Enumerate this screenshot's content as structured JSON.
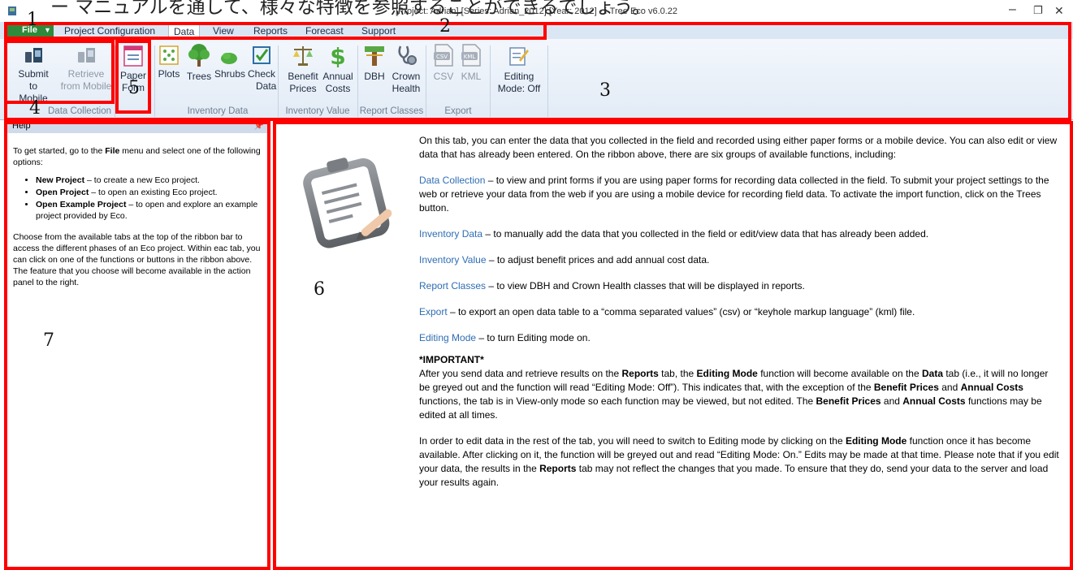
{
  "caption_jp": "ー マニュアルを通して、様々な特徴を参照することができるでしょう。",
  "window": {
    "title": "[Project: Adrian] [Series: Adrian_2012] [Year: 2012] - i-Tree Eco v6.0.22",
    "minimize": "–",
    "restore": "❐",
    "close": "✕"
  },
  "menu": {
    "file": "File",
    "tabs": [
      "Project Configuration",
      "Data",
      "View",
      "Reports",
      "Forecast",
      "Support"
    ]
  },
  "ribbon": {
    "submit_mobile": [
      "Submit",
      "to Mobile"
    ],
    "retrieve_mobile": [
      "Retrieve",
      "from Mobile"
    ],
    "paper_form": [
      "Paper",
      "Form"
    ],
    "plots": "Plots",
    "trees": "Trees",
    "shrubs": "Shrubs",
    "check_data": [
      "Check",
      "Data"
    ],
    "benefit_prices": [
      "Benefit",
      "Prices"
    ],
    "annual_costs": [
      "Annual",
      "Costs"
    ],
    "dbh": "DBH",
    "crown_health": [
      "Crown",
      "Health"
    ],
    "csv": "CSV",
    "kml": "KML",
    "editing_mode": [
      "Editing",
      "Mode: Off"
    ],
    "groups": {
      "data_collection": "Data Collection",
      "inventory_data": "Inventory Data",
      "inventory_value": "Inventory Value",
      "report_classes": "Report Classes",
      "export": "Export"
    }
  },
  "help": {
    "title": "Help",
    "pin": "📌",
    "intro_a": "To get started, go to the ",
    "intro_bold": "File",
    "intro_b": " menu and select one of the following options:",
    "items": [
      {
        "bold": "New Project",
        "text": " – to create a new Eco project."
      },
      {
        "bold": "Open Project",
        "text": " – to open an existing Eco project."
      },
      {
        "bold": "Open Example Project",
        "text": " – to open and explore an example project provided by Eco."
      }
    ],
    "outro": "Choose from the available tabs at the top of the ribbon bar to access the different phases of an Eco project. Within eac tab, you can click on one of the functions or buttons in the ribbon above. The feature that you choose will become available in the action panel to the right."
  },
  "action": {
    "intro": "On this tab, you can enter the data that you collected in the field and recorded using either paper forms or a mobile device. You can also edit or view data that has already been entered. On the ribbon above, there are six groups of available functions, including:",
    "items": [
      {
        "title": "Data Collection",
        "text": " – to view and print forms if you are using paper forms for recording data collected in the field. To submit your project settings to the web or retrieve your data from the web if you are using a mobile device for recording field data. To activate the import function, click on the Trees button."
      },
      {
        "title": "Inventory Data",
        "text": " – to manually add the data that you collected in the field or edit/view data that has already been added."
      },
      {
        "title": "Inventory Value",
        "text": " – to adjust benefit prices and add annual cost data."
      },
      {
        "title": "Report Classes",
        "text": " – to view DBH and Crown Health classes that will be displayed in reports."
      },
      {
        "title": "Export",
        "text": " –  to export an open data table to a “comma separated values” (csv) or “keyhole markup language” (kml) file."
      },
      {
        "title": "Editing Mode",
        "text": " – to turn Editing mode on."
      }
    ],
    "important_title": "*IMPORTANT*",
    "imp1": {
      "t1": "After you send data and retrieve results on the ",
      "b1": "Reports",
      "t2": " tab, the ",
      "b2": "Editing Mode",
      "t3": " function will become available on the ",
      "b3": "Data",
      "t4": " tab (i.e., it will no longer be greyed out and the function will read “Editing Mode: Off”). This indicates that, with the exception of the ",
      "b4": "Benefit Prices",
      "t5": " and ",
      "b5": "Annual Costs",
      "t6": " functions, the tab is in View-only mode so each function may be viewed, but not edited. The ",
      "b6": "Benefit Prices",
      "t7": " and ",
      "b7": "Annual Costs",
      "t8": " functions may be edited at all times."
    },
    "imp2": {
      "t1": "In order to edit data in the rest of the tab, you will need to switch to Editing mode by clicking on the ",
      "b1": "Editing Mode",
      "t2": " function once it has become available. After clicking on it, the function will be greyed out and read “Editing Mode: On.” Edits may be made at that time. Please note that if you edit your data, the results in the ",
      "b2": "Reports",
      "t3": " tab may not reflect the changes that you made. To ensure that they do, send your data to the server and load your results again."
    }
  },
  "annotations": [
    "1",
    "2",
    "3",
    "4",
    "5",
    "6",
    "7"
  ],
  "colors": {
    "annotation": "#ff0000",
    "link": "#2f6db3",
    "file_menu": "#2f8a3b"
  }
}
